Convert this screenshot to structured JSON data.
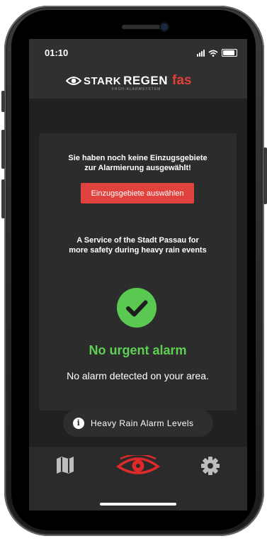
{
  "status_bar": {
    "time": "01:10"
  },
  "header": {
    "logo_stark": "STARK",
    "logo_regen": "REGEN",
    "logo_fas": "fas",
    "logo_subtitle": "FRÜH-ALARMSYSTEM"
  },
  "card": {
    "warning_line1": "Sie haben noch keine Einzugsgebiete",
    "warning_line2": "zur Alarmierung ausgewählt!",
    "select_button": "Einzugsgebiete auswählen",
    "service_line1": "A Service of the Stadt Passau for",
    "service_line2": "more safety during heavy rain events",
    "status_title": "No urgent alarm",
    "status_description": "No alarm detected on your area."
  },
  "levels_button": {
    "label": "Heavy Rain Alarm Levels",
    "icon": "info-icon"
  },
  "tabs": [
    {
      "name": "map",
      "icon": "map-icon"
    },
    {
      "name": "alarm",
      "icon": "eye-icon",
      "active": true
    },
    {
      "name": "settings",
      "icon": "gear-icon"
    }
  ],
  "colors": {
    "accent_red": "#e0433d",
    "success_green": "#5fcf56",
    "background": "#212121",
    "card": "#2c2c2c"
  }
}
